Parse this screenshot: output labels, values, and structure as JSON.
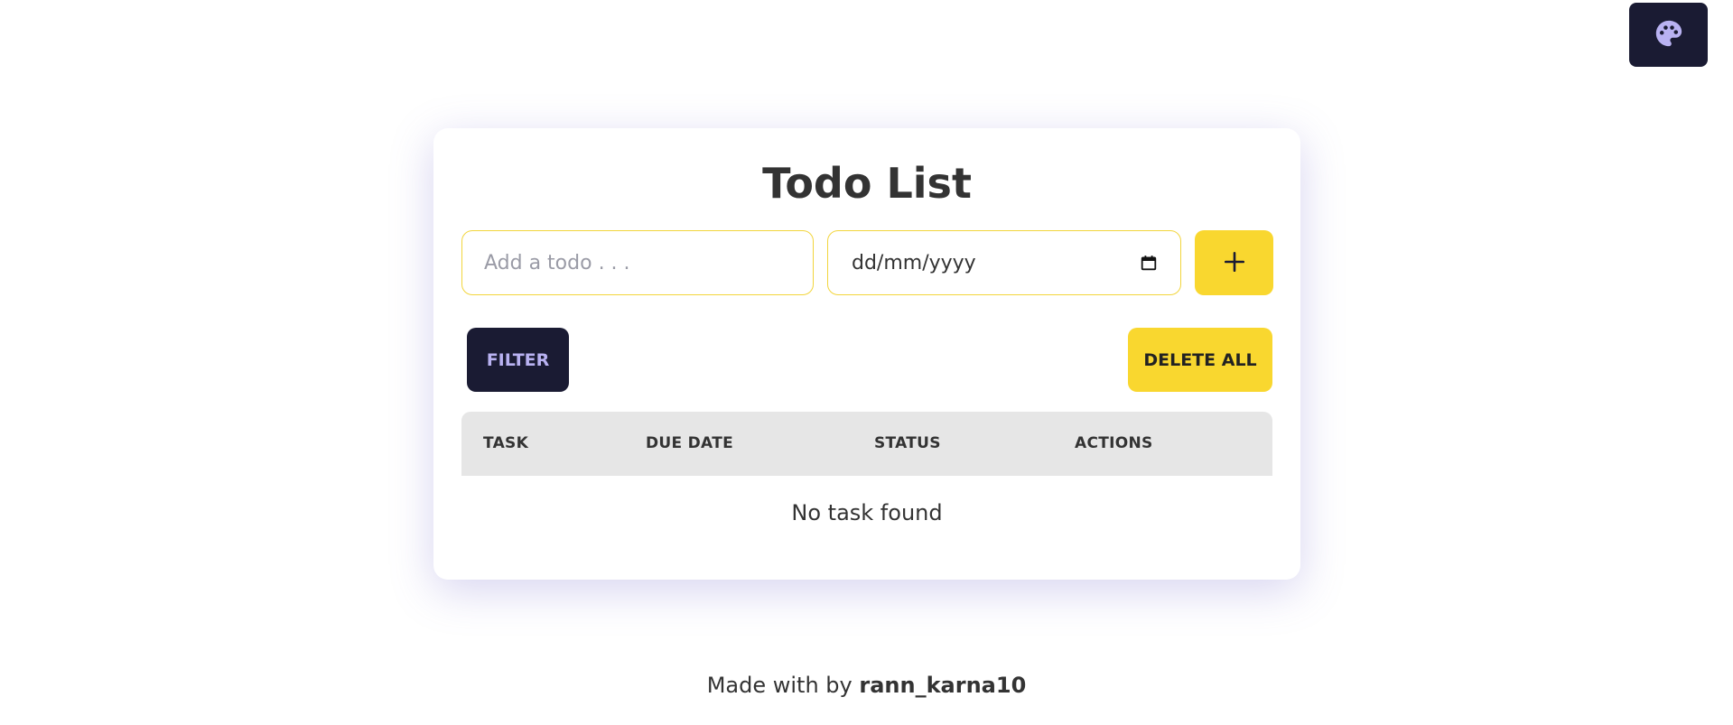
{
  "theme_toggle": {
    "icon": "palette-icon"
  },
  "todo_card": {
    "title": "Todo List",
    "task_input": {
      "placeholder": "Add a todo . . .",
      "value": ""
    },
    "date_input": {
      "display": "dd/mm/yyyy",
      "icon": "calendar-icon"
    },
    "add_button": {
      "icon": "plus-icon"
    },
    "filter_label": "FILTER",
    "delete_all_label": "DELETE ALL",
    "table": {
      "columns": [
        "TASK",
        "DUE DATE",
        "STATUS",
        "ACTIONS"
      ],
      "rows": [],
      "empty_message": "No task found"
    }
  },
  "footer": {
    "prefix": "Made with by",
    "author": "rann_karna10"
  },
  "colors": {
    "accent_yellow": "#f9d72f",
    "dark_navy": "#1a1b33",
    "lavender": "#b9b2f2",
    "table_header_bg": "#e6e6e6",
    "text": "#333333"
  }
}
